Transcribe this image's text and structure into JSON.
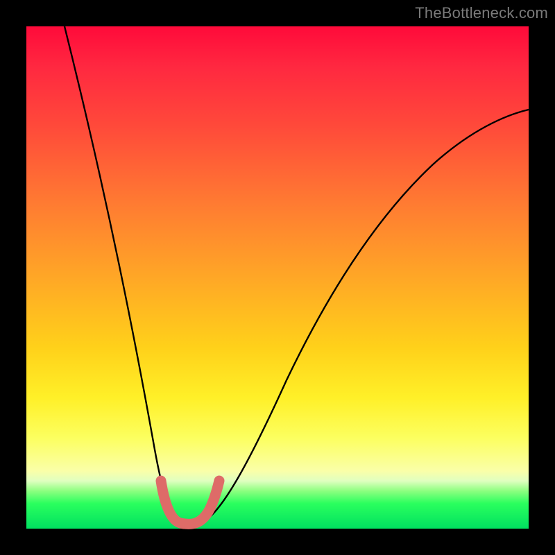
{
  "watermark": "TheBottleneck.com",
  "chart_data": {
    "type": "line",
    "title": "",
    "xlabel": "",
    "ylabel": "",
    "xlim": [
      -10,
      45
    ],
    "ylim": [
      0,
      100
    ],
    "series": [
      {
        "name": "bottleneck-curve",
        "x": [
          -10,
          -8,
          -6,
          -4,
          -2,
          0,
          2,
          4,
          6,
          8,
          10,
          12,
          14,
          16,
          18,
          20,
          24,
          28,
          32,
          36,
          40,
          45
        ],
        "y": [
          100,
          82,
          64,
          46,
          28,
          10,
          3,
          0,
          0,
          3,
          11,
          21,
          31,
          40,
          48,
          55,
          65,
          72,
          77,
          80.5,
          82.5,
          83.5
        ]
      },
      {
        "name": "highlight-marker",
        "x": [
          2,
          3,
          4,
          5,
          6,
          7,
          8
        ],
        "y": [
          5,
          2,
          0.5,
          0,
          0.5,
          2,
          5
        ]
      }
    ],
    "colors": {
      "curve": "#000000",
      "marker": "#de6b68",
      "gradient_top": "#ff0a3a",
      "gradient_mid": "#ffd11a",
      "gradient_bottom": "#00e060"
    }
  }
}
